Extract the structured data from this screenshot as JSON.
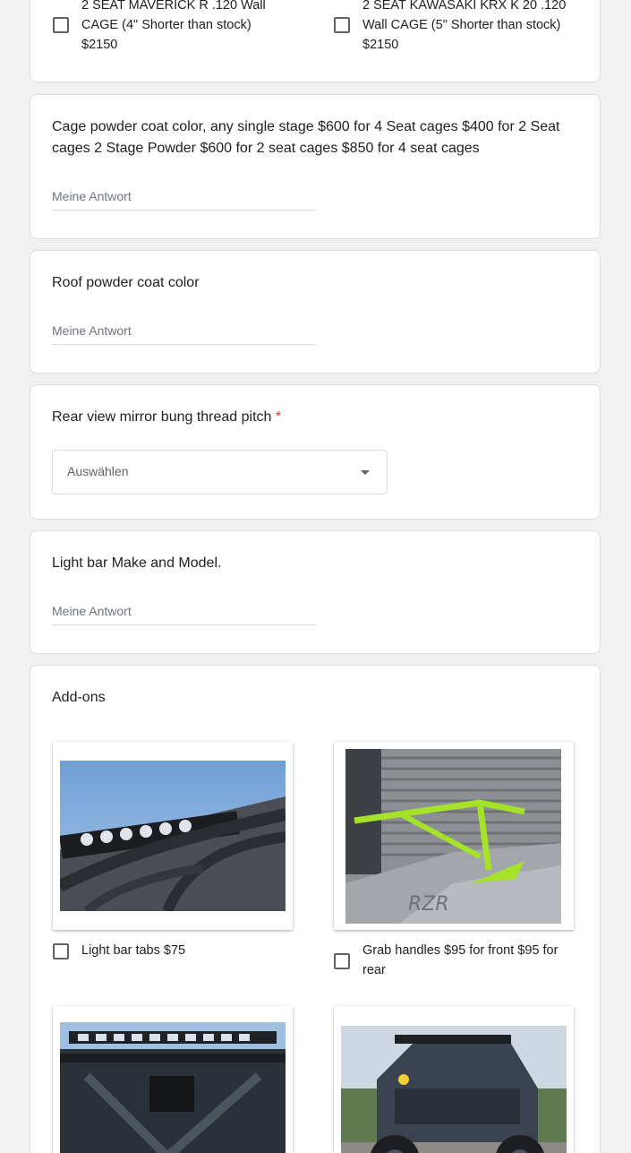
{
  "top_choices": [
    {
      "label": "2 SEAT MAVERICK R .120 Wall CAGE (4\" Shorter than stock) $2150"
    },
    {
      "label": "2 SEAT KAWASAKI KRX K 20 .120 Wall CAGE (5\" Shorter than stock) $2150"
    }
  ],
  "cage_color": {
    "title": "Cage powder coat color,  any single stage $600 for 4 Seat cages $400 for 2 Seat cages 2 Stage Powder $600 for 2 seat cages $850 for 4 seat cages",
    "placeholder": "Meine Antwort"
  },
  "roof_color": {
    "title": "Roof powder coat color",
    "placeholder": "Meine Antwort"
  },
  "mirror_bung": {
    "title": "Rear view mirror bung thread pitch",
    "required_mark": "*",
    "select_text": "Auswählen"
  },
  "light_bar": {
    "title": "Light bar Make and Model.",
    "placeholder": "Meine Antwort"
  },
  "addons": {
    "title": "Add-ons",
    "options": [
      {
        "label": "Light bar tabs $75"
      },
      {
        "label": "Grab handles $95 for front $95 for rear"
      }
    ]
  },
  "colors": {
    "accent_required": "#d93025",
    "card_border": "#dadce0",
    "background": "#f1f1f1"
  }
}
